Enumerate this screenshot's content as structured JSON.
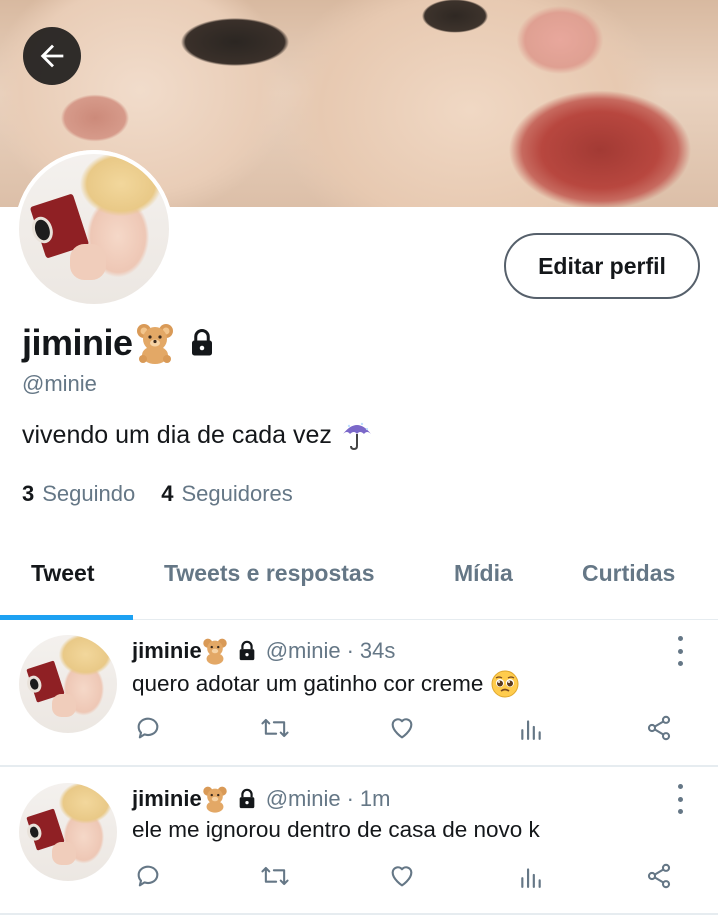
{
  "header": {
    "back_label": "back"
  },
  "profile": {
    "name": "jiminie",
    "handle": "@minie",
    "bio": "vivendo um dia de cada vez",
    "edit_button": "Editar perfil",
    "following_count": "3",
    "following_label": "Seguindo",
    "followers_count": "4",
    "followers_label": "Seguidores"
  },
  "tabs": [
    {
      "label": "Tweet",
      "active": true
    },
    {
      "label": "Tweets e respostas",
      "active": false
    },
    {
      "label": "Mídia",
      "active": false
    },
    {
      "label": "Curtidas",
      "active": false
    }
  ],
  "tweets": [
    {
      "name": "jiminie",
      "handle": "@minie",
      "sep": "·",
      "time": "34s",
      "text": "quero adotar um gatinho cor creme"
    },
    {
      "name": "jiminie",
      "handle": "@minie",
      "sep": "·",
      "time": "1m",
      "text": "ele me ignorou dentro de casa de novo k"
    }
  ],
  "icons": {
    "name_emoji": "teddy-bear-icon",
    "lock": "lock-icon",
    "bio_emoji": "umbrella-icon",
    "tweet1_emoji": "pleading-face-icon"
  },
  "colors": {
    "accent": "#1da1f2",
    "secondary_text": "#657786",
    "primary_text": "#14171a"
  }
}
